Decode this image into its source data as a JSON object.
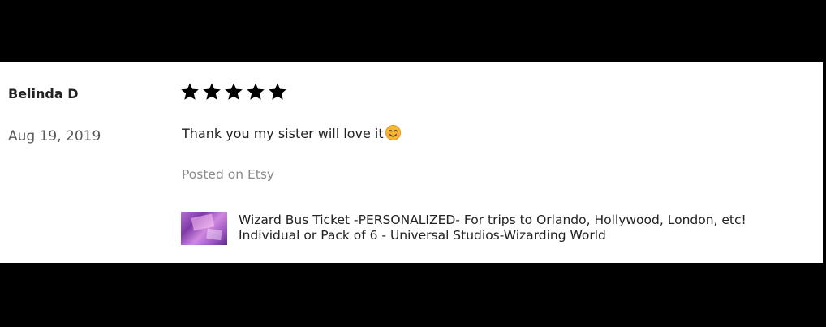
{
  "review": {
    "reviewer_name": "Belinda D",
    "date": "Aug 19, 2019",
    "rating": 5,
    "text": "Thank you my sister will love it",
    "emoji": "smiling-face-icon",
    "posted_on": "Posted on Etsy"
  },
  "listing": {
    "title_line1": "Wizard Bus Ticket -PERSONALIZED- For trips to Orlando, Hollywood, London, etc!",
    "title_line2": "Individual or Pack of 6 - Universal Studios-Wizarding World",
    "thumbnail_icon": "listing-thumbnail"
  },
  "colors": {
    "background_frame": "#000000",
    "card": "#ffffff",
    "text_primary": "#222222",
    "text_muted": "#8a8a8a",
    "star": "#000000"
  }
}
